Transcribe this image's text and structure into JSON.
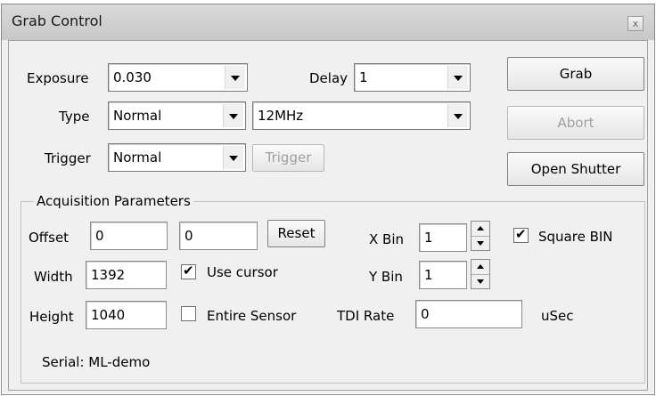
{
  "window": {
    "title": "Grab Control",
    "close_glyph": "x"
  },
  "capture": {
    "exposure_label": "Exposure",
    "exposure_value": "0.030",
    "delay_label": "Delay",
    "delay_value": "1",
    "type_label": "Type",
    "type_value": "Normal",
    "speed_value": "12MHz",
    "trigger_label": "Trigger",
    "trigger_value": "Normal",
    "trigger_button": "Trigger"
  },
  "actions": {
    "grab": "Grab",
    "abort": "Abort",
    "open_shutter": "Open Shutter"
  },
  "acquisition": {
    "title": "Acquisition Parameters",
    "offset_label": "Offset",
    "offset_x": "0",
    "offset_y": "0",
    "reset_button": "Reset",
    "width_label": "Width",
    "width_value": "1392",
    "use_cursor_label": "Use cursor",
    "use_cursor_checked": true,
    "height_label": "Height",
    "height_value": "1040",
    "entire_sensor_label": "Entire Sensor",
    "entire_sensor_checked": false,
    "xbin_label": "X Bin",
    "xbin_value": "1",
    "ybin_label": "Y Bin",
    "ybin_value": "1",
    "square_bin_label": "Square BIN",
    "square_bin_checked": true,
    "tdi_label": "TDI Rate",
    "tdi_value": "0",
    "tdi_unit": "uSec",
    "serial": "Serial: ML-demo"
  }
}
